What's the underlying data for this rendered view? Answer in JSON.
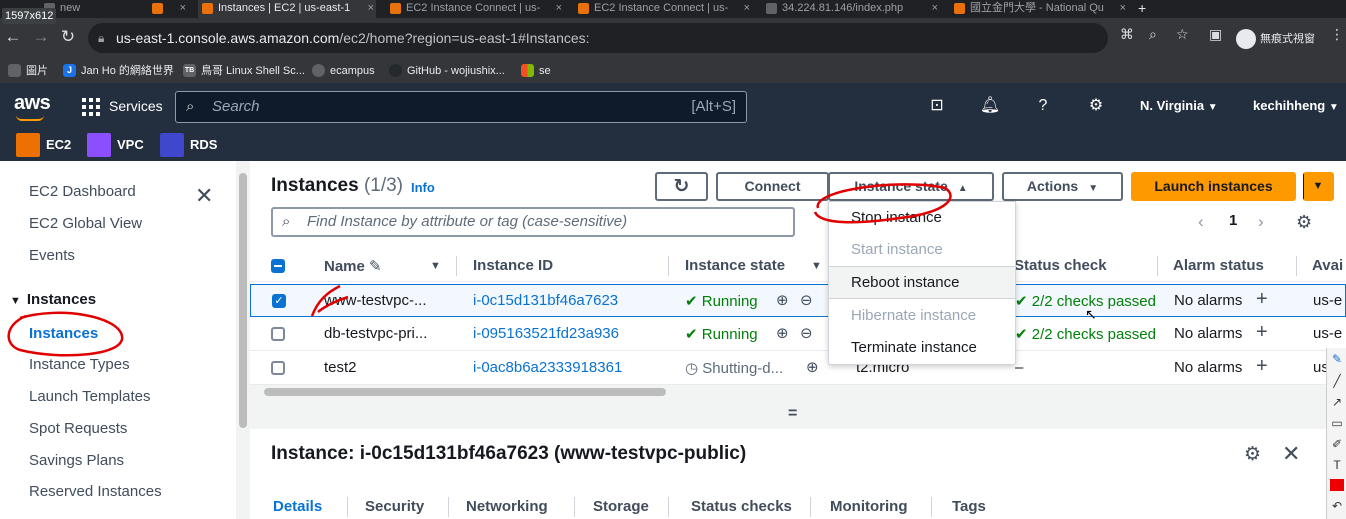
{
  "browser": {
    "dims_label": "1597x612",
    "tabs": [
      {
        "title": "new",
        "color": "#5f6368"
      },
      {
        "title": "",
        "color": "#e8710a"
      },
      {
        "title": "Instances | EC2 | us-east-1",
        "color": "#e8710a"
      },
      {
        "title": "EC2 Instance Connect | us-",
        "color": "#e8710a"
      },
      {
        "title": "EC2 Instance Connect | us-",
        "color": "#e8710a"
      },
      {
        "title": "34.224.81.146/index.php",
        "color": "#5f6368"
      },
      {
        "title": "國立金門大學 - National Qu",
        "color": "#e8710a"
      }
    ],
    "url_host": "us-east-1.console.aws.amazon.com",
    "url_path": "/ec2/home?region=us-east-1#Instances:",
    "profile_label": "無痕式視窗",
    "bookmarks": [
      {
        "label": "圖片",
        "icon": "image-icon",
        "color": "#5f6368"
      },
      {
        "label": "Jan Ho 的網絡世界",
        "icon": "J",
        "color": "#1a73e8"
      },
      {
        "label": "鳥哥 Linux Shell Sc...",
        "icon": "TB",
        "color": "#5f6368"
      },
      {
        "label": "ecampus",
        "icon": "globe-icon",
        "color": "#5f6368"
      },
      {
        "label": "GitHub - wojiushix...",
        "icon": "github-icon",
        "color": "#24292e"
      },
      {
        "label": "se",
        "icon": "microsoft-icon",
        "color": "#f25022"
      }
    ]
  },
  "aws": {
    "logo": "aws",
    "services": "Services",
    "search_placeholder": "Search",
    "search_shortcut": "[Alt+S]",
    "region": "N. Virginia",
    "user": "kechihheng",
    "favorites": [
      {
        "label": "EC2",
        "color": "#ed7100"
      },
      {
        "label": "VPC",
        "color": "#8c4fff"
      },
      {
        "label": "RDS",
        "color": "#3f48cc"
      }
    ]
  },
  "sidebar": {
    "top_items": [
      "EC2 Dashboard",
      "EC2 Global View",
      "Events"
    ],
    "section": "Instances",
    "section_items": [
      "Instances",
      "Instance Types",
      "Launch Templates",
      "Spot Requests",
      "Savings Plans",
      "Reserved Instances"
    ]
  },
  "main": {
    "title": "Instances",
    "count": "(1/3)",
    "info": "Info",
    "buttons": {
      "connect": "Connect",
      "instance_state": "Instance state",
      "actions": "Actions",
      "launch": "Launch instances"
    },
    "filter_placeholder": "Find Instance by attribute or tag (case-sensitive)",
    "page": "1",
    "columns": [
      "Name",
      "Instance ID",
      "Instance state",
      "Status check",
      "Alarm status",
      "Avai"
    ],
    "rows": [
      {
        "name": "www-testvpc-...",
        "id": "i-0c15d131bf46a7623",
        "state": "Running",
        "type": "",
        "status": "2/2 checks passed",
        "alarm": "No alarms",
        "az": "us-e",
        "selected": true
      },
      {
        "name": "db-testvpc-pri...",
        "id": "i-095163521fd23a936",
        "state": "Running",
        "type": "",
        "status": "2/2 checks passed",
        "alarm": "No alarms",
        "az": "us-e",
        "selected": false
      },
      {
        "name": "test2",
        "id": "i-0ac8b6a2333918361",
        "state": "Shutting-d...",
        "type": "t2.micro",
        "status": "–",
        "alarm": "No alarms",
        "az": "us",
        "selected": false
      }
    ],
    "detail_title": "Instance: i-0c15d131bf46a7623 (www-testvpc-public)",
    "detail_tabs": [
      "Details",
      "Security",
      "Networking",
      "Storage",
      "Status checks",
      "Monitoring",
      "Tags"
    ]
  },
  "dropdown": {
    "items": [
      {
        "label": "Stop instance",
        "enabled": true
      },
      {
        "label": "Start instance",
        "enabled": false
      },
      {
        "label": "Reboot instance",
        "enabled": true
      },
      {
        "label": "Hibernate instance",
        "enabled": false
      },
      {
        "label": "Terminate instance",
        "enabled": true
      }
    ]
  },
  "colors": {
    "aws_nav": "#232f3e",
    "primary": "#ff9900",
    "link": "#0972d3",
    "success": "#037f0c",
    "annotation": "#e00000"
  }
}
